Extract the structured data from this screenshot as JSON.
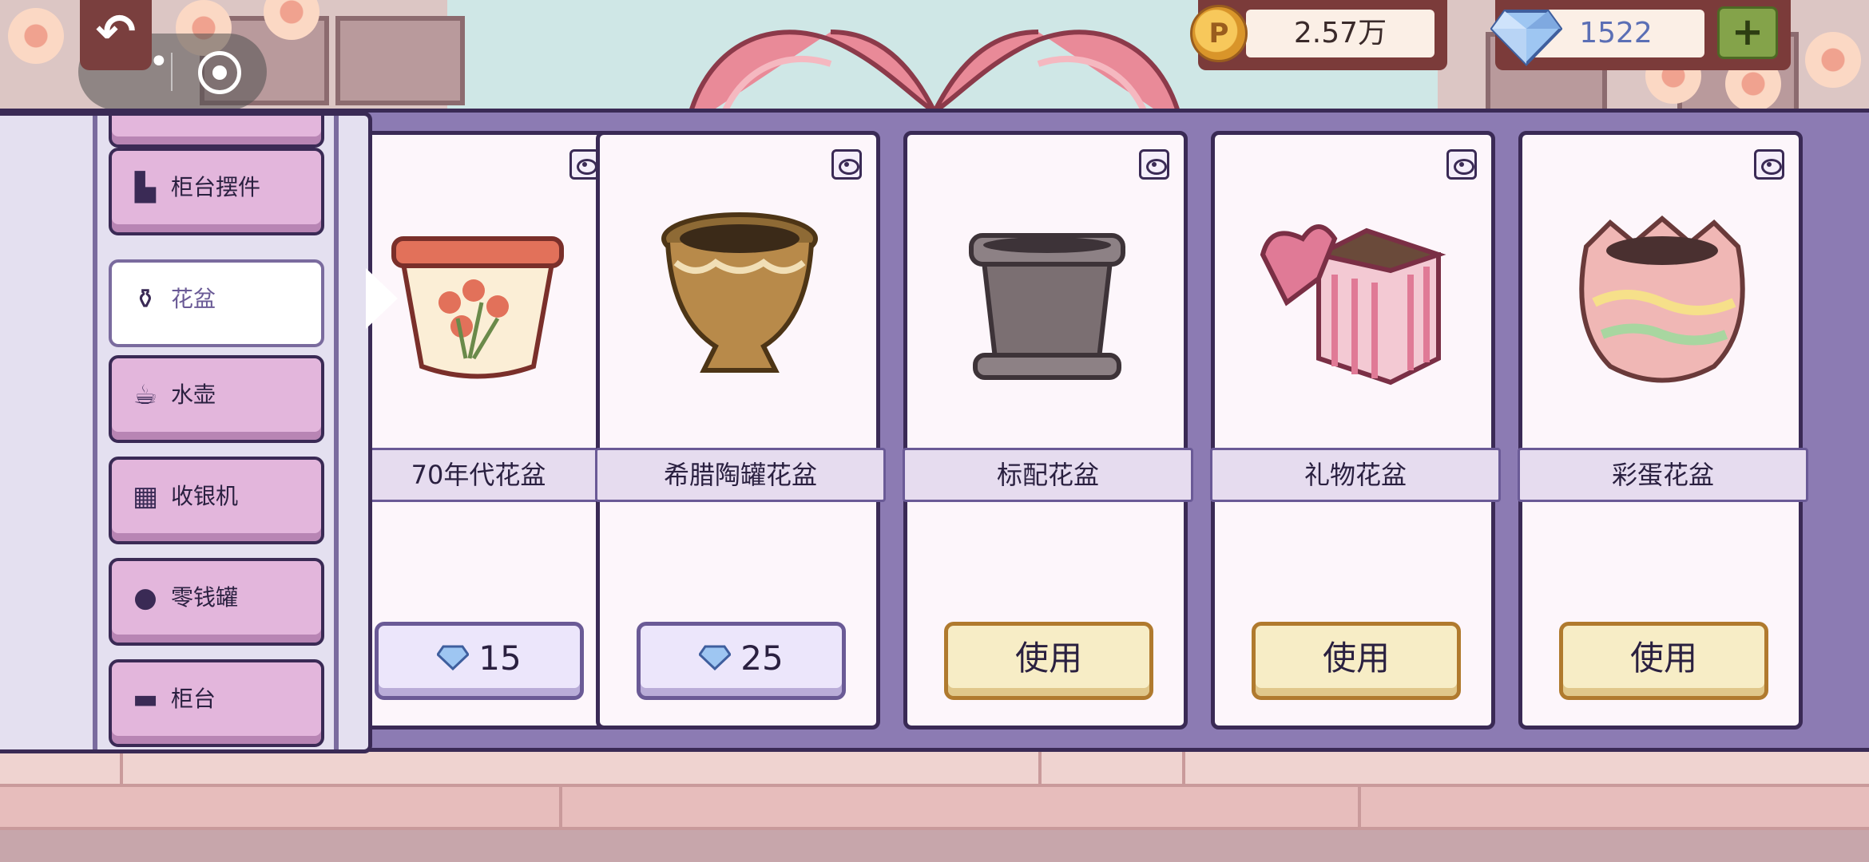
{
  "hud": {
    "coins": "2.57万",
    "gems": "1522",
    "plus_label": "+",
    "back_label": "↶",
    "more_label": "•••"
  },
  "sidebar": {
    "items": [
      {
        "label": "柜台摆件",
        "icon": "counter-decor-icon",
        "active": false
      },
      {
        "label": "花盆",
        "icon": "flowerpot-icon",
        "active": true
      },
      {
        "label": "水壶",
        "icon": "watering-can-icon",
        "active": false
      },
      {
        "label": "收银机",
        "icon": "cash-register-icon",
        "active": false
      },
      {
        "label": "零钱罐",
        "icon": "coin-jar-icon",
        "active": false
      },
      {
        "label": "柜台",
        "icon": "counter-icon",
        "active": false
      }
    ]
  },
  "cards": [
    {
      "name": "70年代花盆",
      "action": "price",
      "price": "15"
    },
    {
      "name": "希腊陶罐花盆",
      "action": "price",
      "price": "25"
    },
    {
      "name": "标配花盆",
      "action": "use",
      "use_label": "使用"
    },
    {
      "name": "礼物花盆",
      "action": "use",
      "use_label": "使用"
    },
    {
      "name": "彩蛋花盆",
      "action": "use",
      "use_label": "使用"
    }
  ],
  "colors": {
    "panel": "#8c7bb3",
    "outline": "#3a2a55",
    "sidebar_item": "#e3b6dc",
    "use_button": "#f7edc6",
    "price_button": "#ece6fb"
  }
}
